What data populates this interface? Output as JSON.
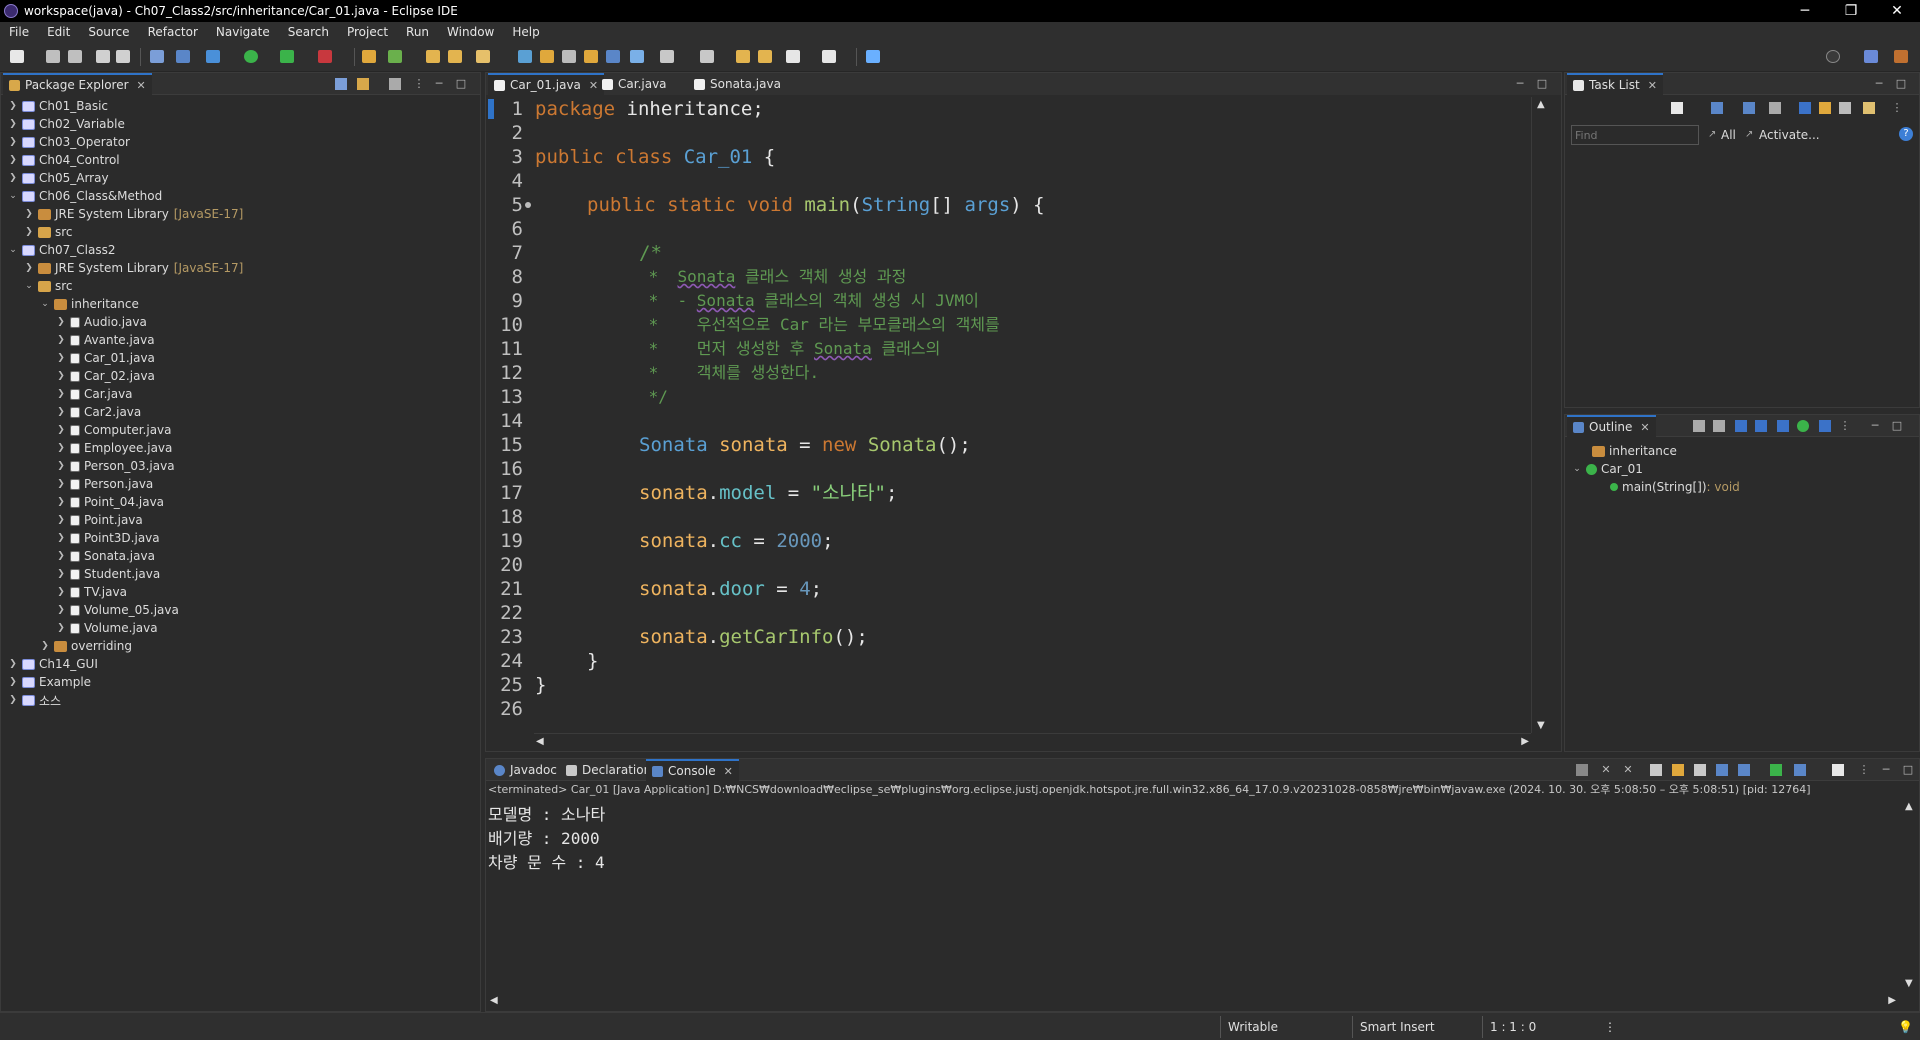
{
  "window": {
    "title": "workspace(java) - Ch07_Class2/src/inheritance/Car_01.java - Eclipse IDE",
    "minimize": "─",
    "restore": "❐",
    "close": "✕"
  },
  "menu": [
    "File",
    "Edit",
    "Source",
    "Refactor",
    "Navigate",
    "Search",
    "Project",
    "Run",
    "Window",
    "Help"
  ],
  "package_explorer": {
    "title": "Package Explorer",
    "items": [
      {
        "label": "Ch01_Basic",
        "expanded": false
      },
      {
        "label": "Ch02_Variable",
        "expanded": false
      },
      {
        "label": "Ch03_Operator",
        "expanded": false
      },
      {
        "label": "Ch04_Control",
        "expanded": false
      },
      {
        "label": "Ch05_Array",
        "expanded": false
      },
      {
        "label": "Ch06_Class&Method",
        "expanded": true
      },
      {
        "label": "JRE System Library",
        "decoration": "[JavaSE-17]"
      },
      {
        "label": "src"
      },
      {
        "label": "Ch07_Class2",
        "expanded": true
      },
      {
        "label": "JRE System Library",
        "decoration": "[JavaSE-17]"
      },
      {
        "label": "src",
        "expanded": true
      },
      {
        "label": "inheritance",
        "expanded": true
      },
      {
        "label": "Audio.java"
      },
      {
        "label": "Avante.java"
      },
      {
        "label": "Car_01.java"
      },
      {
        "label": "Car_02.java"
      },
      {
        "label": "Car.java"
      },
      {
        "label": "Car2.java"
      },
      {
        "label": "Computer.java"
      },
      {
        "label": "Employee.java"
      },
      {
        "label": "Person_03.java"
      },
      {
        "label": "Person.java"
      },
      {
        "label": "Point_04.java"
      },
      {
        "label": "Point.java"
      },
      {
        "label": "Point3D.java"
      },
      {
        "label": "Sonata.java"
      },
      {
        "label": "Student.java"
      },
      {
        "label": "TV.java"
      },
      {
        "label": "Volume_05.java"
      },
      {
        "label": "Volume.java"
      },
      {
        "label": "overriding"
      },
      {
        "label": "Ch14_GUI"
      },
      {
        "label": "Example"
      },
      {
        "label": "소스"
      }
    ]
  },
  "editor": {
    "tabs": [
      "Car_01.java",
      "Car.java",
      "Sonata.java"
    ],
    "active_tab": "Car_01.java",
    "line_numbers": [
      "1",
      "2",
      "3",
      "4",
      "5",
      "6",
      "7",
      "8",
      "9",
      "10",
      "11",
      "12",
      "13",
      "14",
      "15",
      "16",
      "17",
      "18",
      "19",
      "20",
      "21",
      "22",
      "23",
      "24",
      "25",
      "26"
    ]
  },
  "code": {
    "l1_kw": "package",
    "l1_rest": " inheritance;",
    "l3_kw": "public class ",
    "l3_cls": "Car_01",
    "l3_rest": " {",
    "l5_kw": "public static void ",
    "l5_fn": "main",
    "l5_p1": "(",
    "l5_ty": "String",
    "l5_p2": "[] ",
    "l5_arg": "args",
    "l5_p3": ") {",
    "l7": "/*",
    "l8a": " *  ",
    "l8b": "Sonata",
    "l8c": " 클래스 객체 생성 과정",
    "l9a": " *  - ",
    "l9b": "Sonata",
    "l9c": " 클래스의 객체 생성 시 JVM이",
    "l10": " *    우선적으로 Car 라는 부모클래스의 객체를",
    "l11a": " *    먼저 생성한 후 ",
    "l11b": "Sonata",
    "l11c": " 클래스의",
    "l12": " *    객체를 생성한다.",
    "l13": " */",
    "l15_ty": "Sonata",
    "l15_var": " sonata",
    "l15_eq": " = ",
    "l15_kw": "new ",
    "l15_fn": "Sonata",
    "l15_end": "();",
    "l17_obj": "sonata",
    "l17_dot": ".",
    "l17_fld": "model",
    "l17_eq": " = ",
    "l17_str": "\"소나타\"",
    "l17_end": ";",
    "l19_obj": "sonata",
    "l19_dot": ".",
    "l19_fld": "cc",
    "l19_eq": " = ",
    "l19_num": "2000",
    "l19_end": ";",
    "l21_obj": "sonata",
    "l21_dot": ".",
    "l21_fld": "door",
    "l21_eq": " = ",
    "l21_num": "4",
    "l21_end": ";",
    "l23_obj": "sonata",
    "l23_dot": ".",
    "l23_fn": "getCarInfo",
    "l23_end": "();",
    "l24": "}",
    "l25": "}"
  },
  "task_list": {
    "title": "Task List",
    "find_placeholder": "Find",
    "all": "All",
    "activate": "Activate..."
  },
  "outline": {
    "title": "Outline",
    "items": [
      "inheritance",
      "Car_01",
      "main(String[])"
    ],
    "return_type": " : void"
  },
  "bottom": {
    "tabs": [
      "Javadoc",
      "Declaration",
      "Console"
    ],
    "active_tab": "Console",
    "terminated": "<terminated> Car_01 [Java Application] D:₩NCS₩download₩eclipse_se₩plugins₩org.eclipse.justj.openjdk.hotspot.jre.full.win32.x86_64_17.0.9.v20231028-0858₩jre₩bin₩javaw.exe  (2024. 10. 30. 오후 5:08:50 – 오후 5:08:51) [pid: 12764]",
    "output": [
      "모델명 : 소나타",
      "배기량 : 2000",
      "차량 문 수 : 4"
    ]
  },
  "status": {
    "writable": "Writable",
    "insert": "Smart Insert",
    "position": "1 : 1 : 0"
  },
  "colors": {
    "accent": "#2f73c8",
    "background": "#2b2b2b",
    "keyword": "#cc7832",
    "comment": "#5f9a52"
  }
}
